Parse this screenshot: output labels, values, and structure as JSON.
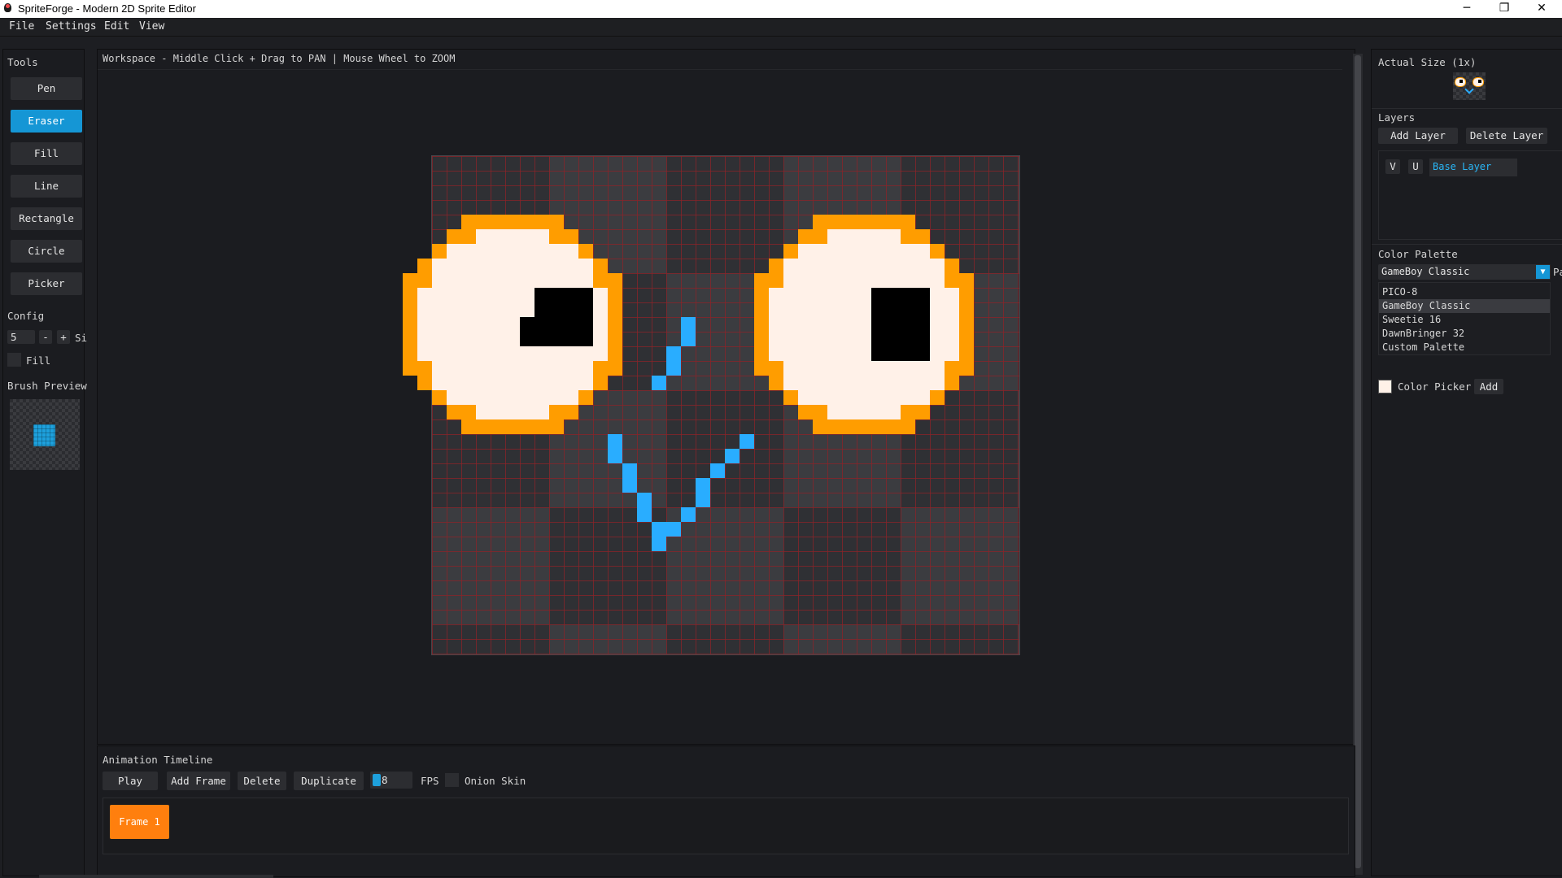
{
  "window": {
    "title": "SpriteForge - Modern 2D Sprite Editor",
    "minimize": "─",
    "maximize": "❐",
    "close": "✕"
  },
  "menu": [
    "File",
    "Settings",
    "Edit",
    "View"
  ],
  "tools": {
    "title": "Tools",
    "items": [
      "Pen",
      "Eraser",
      "Fill",
      "Line",
      "Rectangle",
      "Circle",
      "Picker"
    ],
    "active": "Eraser"
  },
  "config": {
    "title": "Config",
    "size_value": "5",
    "minus": "-",
    "plus": "+",
    "size_label": "Si",
    "fill_label": "Fill",
    "fill_checked": false
  },
  "brush_preview": {
    "title": "Brush Preview",
    "color": "#1ea0dc"
  },
  "workspace": {
    "hint": "Workspace - Middle Click + Drag to PAN | Mouse Wheel to ZOOM",
    "sprite_cells": 40,
    "sprite_rows": 34,
    "colors": {
      "outline": "#ff9d00",
      "white": "#fff1e8",
      "black": "#000000",
      "blue": "#29adff"
    }
  },
  "preview": {
    "title": "Actual Size (1x)"
  },
  "layers": {
    "title": "Layers",
    "add": "Add Layer",
    "delete": "Delete Layer",
    "items": [
      {
        "v": "V",
        "u": "U",
        "name": "Base Layer"
      }
    ]
  },
  "palette": {
    "title": "Color Palette",
    "selected": "GameBoy Classic",
    "side_label": "Pa",
    "options": [
      "PICO-8",
      "GameBoy Classic",
      "Sweetie 16",
      "DawnBringer 32",
      "Custom Palette"
    ],
    "color_picker_label": "Color Picker",
    "add": "Add",
    "swatch": "#fff1e8"
  },
  "timeline": {
    "title": "Animation Timeline",
    "play": "Play",
    "add_frame": "Add Frame",
    "delete": "Delete",
    "duplicate": "Duplicate",
    "fps_value": "8",
    "fps_label": "FPS",
    "onion_label": "Onion Skin",
    "frames": [
      "Frame 1"
    ]
  },
  "accent": "#1596d5",
  "frame_color": "#ff7f0e"
}
